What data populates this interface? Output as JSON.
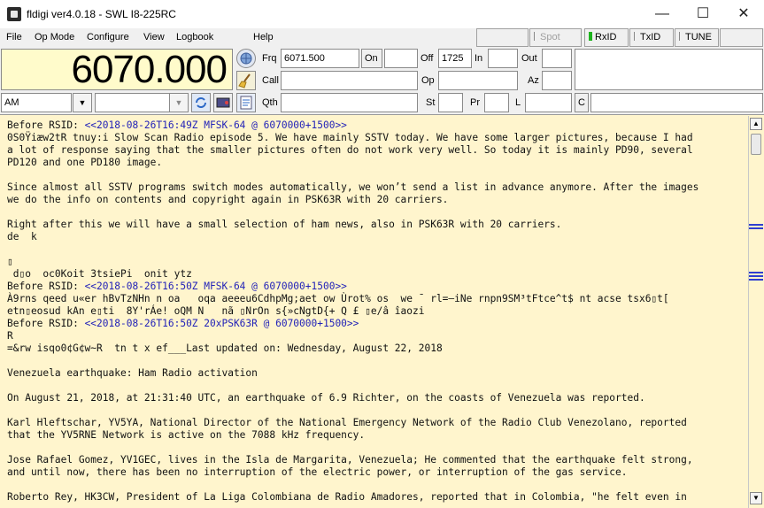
{
  "window": {
    "title": "fldigi ver4.0.18 - SWL I8-225RC",
    "minimize_glyph": "—",
    "maximize_glyph": "☐",
    "close_glyph": "✕"
  },
  "menu": [
    "File",
    "Op Mode",
    "Configure",
    "View",
    "Logbook",
    "Help"
  ],
  "toolbar": {
    "spot": "Spot",
    "rxid": "RxID",
    "txid": "TxID",
    "tune": "TUNE"
  },
  "frequency_display": "6070.000",
  "fields": {
    "frq_label": "Frq",
    "frq_value": "6071.500",
    "on_label": "On",
    "on_value": "",
    "off_label": "Off",
    "off_value": "1725",
    "in_label": "In",
    "in_value": "",
    "out_label": "Out",
    "out_value": "",
    "call_label": "Call",
    "call_value": "",
    "op_label": "Op",
    "op_value": "",
    "az_label": "Az",
    "az_value": "",
    "qth_label": "Qth",
    "qth_value": "",
    "st_label": "St",
    "st_value": "",
    "pr_label": "Pr",
    "pr_value": "",
    "l_label": "L",
    "l_value": "",
    "c_label": "C",
    "c_value": "",
    "mode_value": "AM",
    "bw_value": ""
  },
  "rx_lines": [
    {
      "text": "Before RSID: ",
      "link": "<<2018-08-26T16:49Z MFSK-64 @ 6070000+1500>>"
    },
    {
      "text": "0S0Ÿiæw2tR tnuy:i Slow Scan Radio episode 5. We have mainly SSTV today. We have some larger pictures, because I had"
    },
    {
      "text": "a lot of response saying that the smaller pictures often do not work very well. So today it is mainly PD90, several"
    },
    {
      "text": "PD120 and one PD180 image."
    },
    {
      "text": ""
    },
    {
      "text": "Since almost all SSTV programs switch modes automatically, we won’t send a list in advance anymore. After the images"
    },
    {
      "text": "we do the info on contents and copyright again in PSK63R with 20 carriers."
    },
    {
      "text": ""
    },
    {
      "text": "Right after this we will have a small selection of ham news, also in PSK63R with 20 carriers."
    },
    {
      "text": "de  k"
    },
    {
      "text": ""
    },
    {
      "text": "▯"
    },
    {
      "text": " d▯o  oc0Koit 3tsiePi  onit ytz"
    },
    {
      "text": "Before RSID: ",
      "link": "<<2018-08-26T16:50Z MFSK-64 @ 6070000+1500>>"
    },
    {
      "text": "À9rns qeed u«er hBvTzNHn n oa   oqa aeeeu6CdhpMg;aet ow Ùrot% os  we ˉ rl=—iNe rnpn9SM³tFtce^t$ nt acse tsx6▯t["
    },
    {
      "text": "etn▯eosud kAn e▯ti  8Y'rÁe! oQM N   nã ▯NrOn s{»cNgtD{+ Q £ ▯e/â îaozi"
    },
    {
      "text": "Before RSID: ",
      "link": "<<2018-08-26T16:50Z 20xPSK63R @ 6070000+1500>>"
    },
    {
      "text": "R"
    },
    {
      "text": "=&rw isqo0¢G¢w~R  tn t x ef___Last updated on: Wednesday, August 22, 2018"
    },
    {
      "text": ""
    },
    {
      "text": "Venezuela earthquake: Ham Radio activation"
    },
    {
      "text": ""
    },
    {
      "text": "On August 21, 2018, at 21:31:40 UTC, an earthquake of 6.9 Richter, on the coasts of Venezuela was reported."
    },
    {
      "text": ""
    },
    {
      "text": "Karl Hleftschar, YV5YA, National Director of the National Emergency Network of the Radio Club Venezolano, reported"
    },
    {
      "text": "that the YV5RNE Network is active on the 7088 kHz frequency."
    },
    {
      "text": ""
    },
    {
      "text": "Jose Rafael Gomez, YV1GEC, lives in the Isla de Margarita, Venezuela; He commented that the earthquake felt strong,"
    },
    {
      "text": "and until now, there has been no interruption of the electric power, or interruption of the gas service."
    },
    {
      "text": ""
    },
    {
      "text": "Roberto Rey, HK3CW, President of La Liga Colombiana de Radio Amadores, reported that in Colombia, \"he felt even in"
    }
  ],
  "colors": {
    "rx_background": "#fff5cd",
    "rsid_link": "#2323b8",
    "freq_background": "#fffbcb",
    "scroll_mark": "#2f3fd0"
  }
}
